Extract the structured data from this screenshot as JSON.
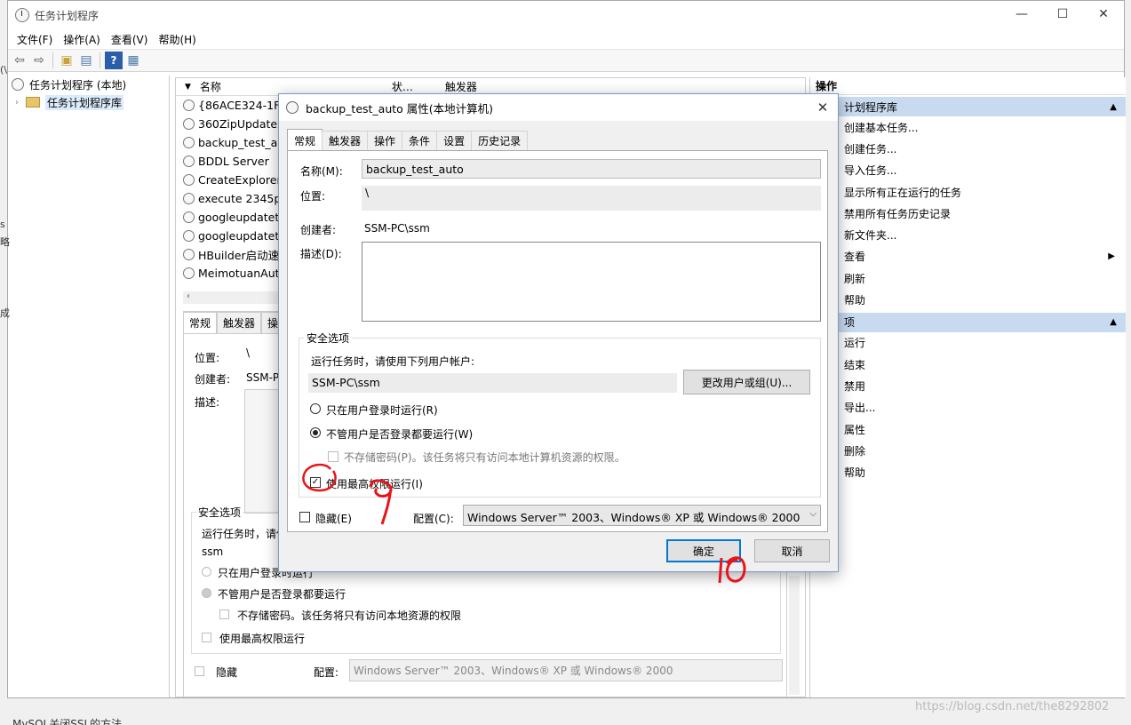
{
  "window": {
    "title": "任务计划程序",
    "controls": [
      "—",
      "☐",
      "✕"
    ]
  },
  "menu": [
    "文件(F)",
    "操作(A)",
    "查看(V)",
    "帮助(H)"
  ],
  "toolbar": {
    "icons": [
      "back-arrow-icon",
      "forward-arrow-icon",
      "up-folder-icon",
      "show-hide-tree-icon",
      "help-icon",
      "properties-icon"
    ]
  },
  "tree": {
    "root": "任务计划程序 (本地)",
    "library": "任务计划程序库"
  },
  "list": {
    "headers": [
      "名称",
      "状…",
      "触发器"
    ],
    "tasks": [
      "{86ACE324-1F30",
      "360ZipUpdater",
      "backup_test_aut",
      "BDDL Server",
      "CreateExplorerS",
      "execute 2345pin",
      "googleupdateta",
      "googleupdateta",
      "HBuilder启动速度",
      "MeimotuanAuto"
    ]
  },
  "detail": {
    "tabs": [
      "常规",
      "触发器",
      "操"
    ],
    "location_label": "位置:",
    "location_value": "\\",
    "author_label": "创建者:",
    "author_value": "SSM-PC",
    "desc_label": "描述:",
    "security_title": "安全选项",
    "run_as_text": "运行任务时，请使",
    "user": "ssm",
    "opt_logged_on": "只在用户登录时运行",
    "opt_whether": "不管用户是否登录都要运行",
    "opt_no_store": "不存储密码。该任务将只有访问本地资源的权限",
    "opt_highest": "使用最高权限运行",
    "hidden": "隐藏",
    "config_label": "配置:",
    "config_value": "Windows Server™ 2003、Windows® XP 或 Windows® 2000"
  },
  "actions": {
    "header": "操作",
    "group1": "计划程序库",
    "group1_items": [
      "创建基本任务...",
      "创建任务...",
      "导入任务...",
      "显示所有正在运行的任务",
      "禁用所有任务历史记录",
      "新文件夹...",
      "查看",
      "刷新",
      "帮助"
    ],
    "group2": "项",
    "group2_items": [
      "运行",
      "结束",
      "禁用",
      "导出...",
      "属性",
      "删除",
      "帮助"
    ]
  },
  "dialog": {
    "title": "backup_test_auto 属性(本地计算机)",
    "tabs": [
      "常规",
      "触发器",
      "操作",
      "条件",
      "设置",
      "历史记录"
    ],
    "name_label": "名称(M):",
    "name_value": "backup_test_auto",
    "location_label": "位置:",
    "location_value": "\\",
    "author_label": "创建者:",
    "author_value": "SSM-PC\\ssm",
    "desc_label": "描述(D):",
    "security_title": "安全选项",
    "run_as_text": "运行任务时，请使用下列用户帐户:",
    "user_value": "SSM-PC\\ssm",
    "change_user_button": "更改用户或组(U)...",
    "opt_logged_on": "只在用户登录时运行(R)",
    "opt_whether": "不管用户是否登录都要运行(W)",
    "opt_no_store": "不存储密码(P)。该任务将只有访问本地计算机资源的权限。",
    "opt_highest": "使用最高权限运行(I)",
    "hidden": "隐藏(E)",
    "config_label": "配置(C):",
    "config_value": "Windows Server™ 2003、Windows® XP 或 Windows® 2000",
    "ok": "确定",
    "cancel": "取消"
  },
  "annotations": {
    "step9": "9",
    "step10": "10",
    "annotation_color": "#e8141b"
  },
  "watermark": "https://blog.csdn.net/the8292802",
  "bottom_text": "MySQL关闭SSL的方法",
  "left_edge": [
    "(\\",
    "s",
    "略",
    "成"
  ]
}
